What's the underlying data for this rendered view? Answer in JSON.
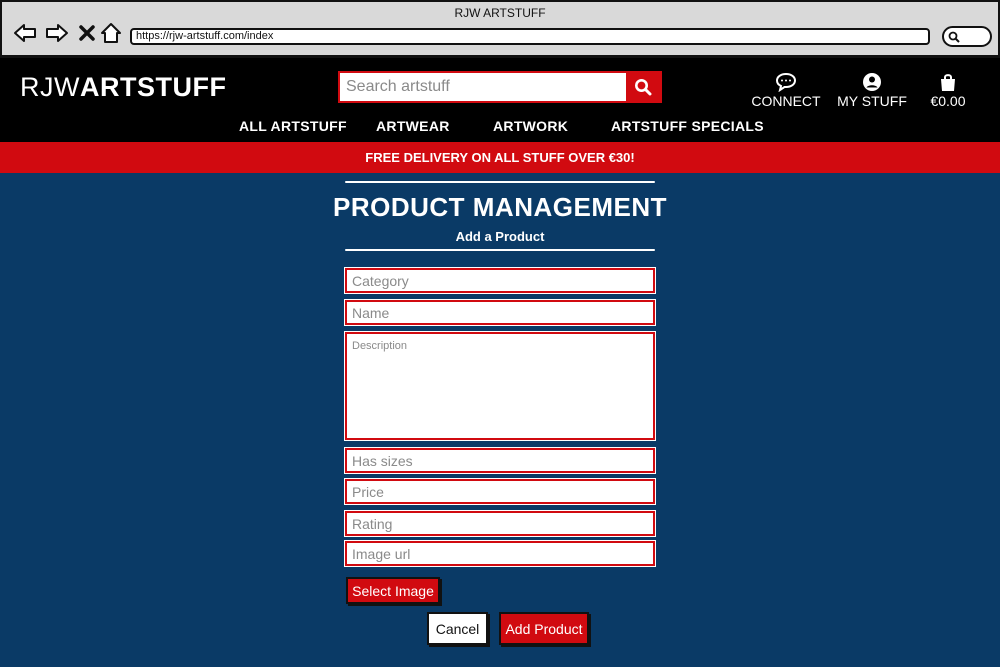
{
  "browser": {
    "title": "RJW ARTSTUFF",
    "url": "https://rjw-artstuff.com/index"
  },
  "header": {
    "logo_light": "RJW",
    "logo_bold": "ARTSTUFF",
    "search_placeholder": "Search artstuff",
    "connect_label": "CONNECT",
    "mystuff_label": "MY STUFF",
    "bag_total": "€0.00"
  },
  "nav": {
    "items": [
      "ALL ARTSTUFF",
      "ARTWEAR",
      "ARTWORK",
      "ARTSTUFF SPECIALS"
    ]
  },
  "banner": {
    "text": "FREE DELIVERY ON ALL STUFF OVER €30!"
  },
  "form": {
    "title": "PRODUCT MANAGEMENT",
    "subtitle": "Add a Product",
    "category_placeholder": "Category",
    "name_placeholder": "Name",
    "description_placeholder": "Description",
    "has_sizes_placeholder": "Has sizes",
    "price_placeholder": "Price",
    "rating_placeholder": "Rating",
    "image_url_placeholder": "Image url",
    "select_image_label": "Select Image",
    "cancel_label": "Cancel",
    "add_product_label": "Add Product"
  },
  "colors": {
    "accent_red": "#d10a10",
    "page_blue": "#0a3a66",
    "header_black": "#000000"
  }
}
